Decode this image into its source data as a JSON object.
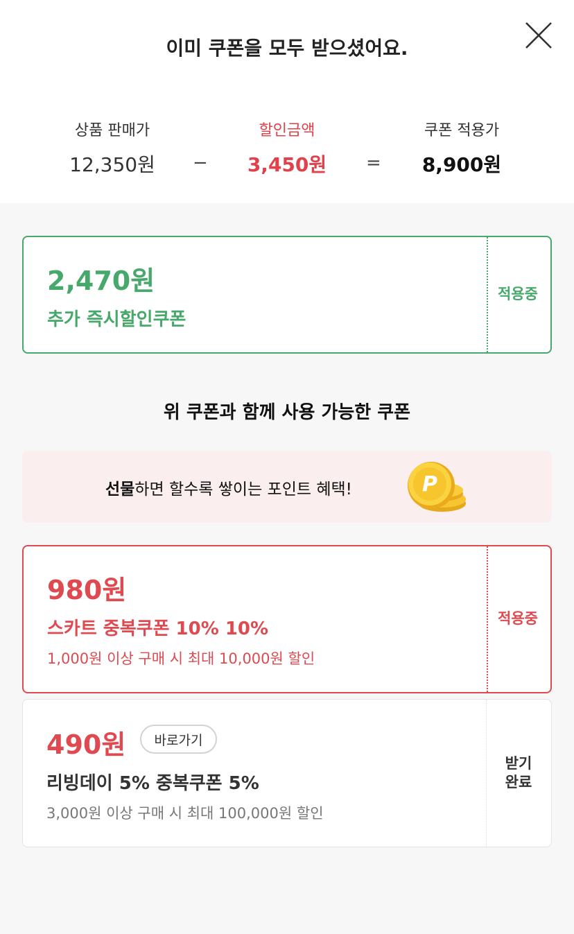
{
  "header": {
    "title": "이미 쿠폰을 모두 받으셨어요.",
    "close_icon": "close-icon"
  },
  "price_summary": {
    "sale_label": "상품 판매가",
    "sale_value": "12,350원",
    "minus": "−",
    "discount_label": "할인금액",
    "discount_value": "3,450원",
    "equals": "=",
    "final_label": "쿠폰 적용가",
    "final_value": "8,900원"
  },
  "instant_coupon": {
    "amount": "2,470원",
    "name": "추가 즉시할인쿠폰",
    "status": "적용중",
    "color": "#46a86a"
  },
  "section": {
    "title": "위 쿠폰과 함께 사용 가능한 쿠폰"
  },
  "banner": {
    "text_bold": "선물",
    "text_rest": "하면 할수록 쌓이는 포인트 혜택!",
    "icon": "point-coin-icon",
    "coin_letter": "P",
    "background": "#fbeeee"
  },
  "coupons": [
    {
      "amount": "980원",
      "name": "스카트 중복쿠폰 10% 10%",
      "condition": "1,000원 이상 구매 시 최대 10,000원 할인",
      "status": "적용중",
      "color": "#de4a50"
    },
    {
      "amount": "490원",
      "goto_label": "바로가기",
      "name": "리빙데이 5% 중복쿠폰 5%",
      "condition": "3,000원 이상 구매 시 최대 100,000원 할인",
      "status_line1": "받기",
      "status_line2": "완료"
    }
  ]
}
